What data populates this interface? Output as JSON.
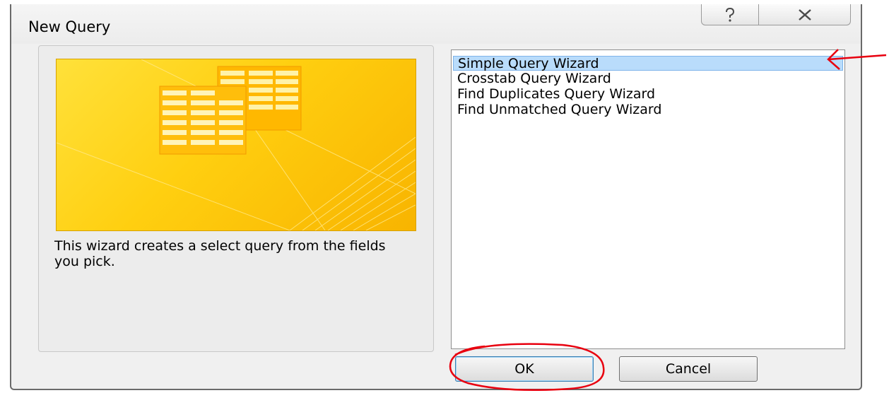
{
  "dialog": {
    "title": "New Query",
    "help_icon": "question-mark-icon",
    "close_icon": "close-x-icon"
  },
  "preview": {
    "description": "This wizard creates a select query from the fields you pick."
  },
  "wizards": {
    "items": [
      {
        "label": "Simple Query Wizard",
        "selected": true
      },
      {
        "label": "Crosstab Query Wizard",
        "selected": false
      },
      {
        "label": "Find Duplicates Query Wizard",
        "selected": false
      },
      {
        "label": "Find Unmatched Query Wizard",
        "selected": false
      }
    ]
  },
  "buttons": {
    "ok_label": "OK",
    "cancel_label": "Cancel"
  },
  "colors": {
    "selection": "#b9dcfb",
    "illustration": "#ffcf10",
    "annotation": "#e8000f"
  }
}
